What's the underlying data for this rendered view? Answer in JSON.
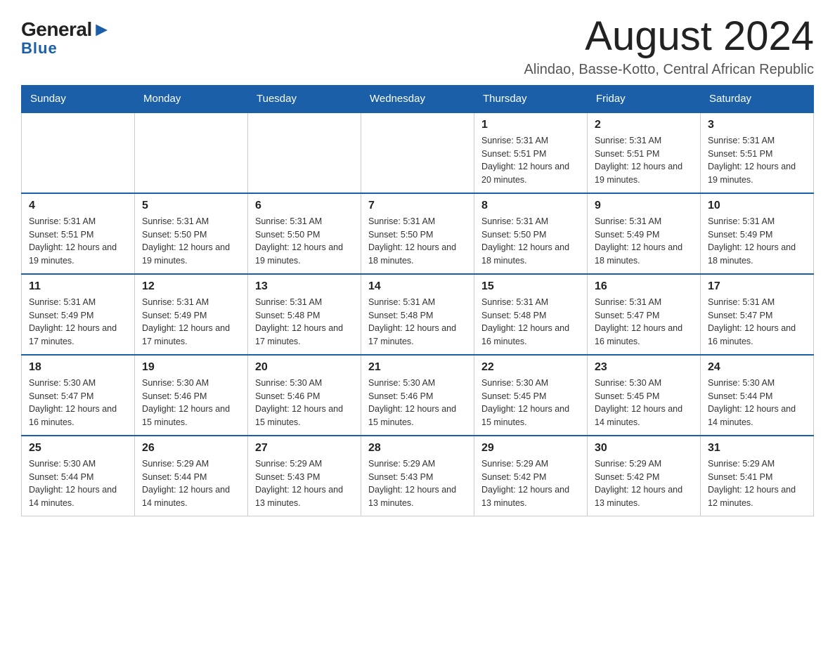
{
  "logo": {
    "general": "General",
    "arrow": "▶",
    "blue": "Blue"
  },
  "title": {
    "month_year": "August 2024",
    "location": "Alindao, Basse-Kotto, Central African Republic"
  },
  "days_of_week": [
    "Sunday",
    "Monday",
    "Tuesday",
    "Wednesday",
    "Thursday",
    "Friday",
    "Saturday"
  ],
  "weeks": [
    [
      {
        "day": "",
        "sunrise": "",
        "sunset": "",
        "daylight": ""
      },
      {
        "day": "",
        "sunrise": "",
        "sunset": "",
        "daylight": ""
      },
      {
        "day": "",
        "sunrise": "",
        "sunset": "",
        "daylight": ""
      },
      {
        "day": "",
        "sunrise": "",
        "sunset": "",
        "daylight": ""
      },
      {
        "day": "1",
        "sunrise": "Sunrise: 5:31 AM",
        "sunset": "Sunset: 5:51 PM",
        "daylight": "Daylight: 12 hours and 20 minutes."
      },
      {
        "day": "2",
        "sunrise": "Sunrise: 5:31 AM",
        "sunset": "Sunset: 5:51 PM",
        "daylight": "Daylight: 12 hours and 19 minutes."
      },
      {
        "day": "3",
        "sunrise": "Sunrise: 5:31 AM",
        "sunset": "Sunset: 5:51 PM",
        "daylight": "Daylight: 12 hours and 19 minutes."
      }
    ],
    [
      {
        "day": "4",
        "sunrise": "Sunrise: 5:31 AM",
        "sunset": "Sunset: 5:51 PM",
        "daylight": "Daylight: 12 hours and 19 minutes."
      },
      {
        "day": "5",
        "sunrise": "Sunrise: 5:31 AM",
        "sunset": "Sunset: 5:50 PM",
        "daylight": "Daylight: 12 hours and 19 minutes."
      },
      {
        "day": "6",
        "sunrise": "Sunrise: 5:31 AM",
        "sunset": "Sunset: 5:50 PM",
        "daylight": "Daylight: 12 hours and 19 minutes."
      },
      {
        "day": "7",
        "sunrise": "Sunrise: 5:31 AM",
        "sunset": "Sunset: 5:50 PM",
        "daylight": "Daylight: 12 hours and 18 minutes."
      },
      {
        "day": "8",
        "sunrise": "Sunrise: 5:31 AM",
        "sunset": "Sunset: 5:50 PM",
        "daylight": "Daylight: 12 hours and 18 minutes."
      },
      {
        "day": "9",
        "sunrise": "Sunrise: 5:31 AM",
        "sunset": "Sunset: 5:49 PM",
        "daylight": "Daylight: 12 hours and 18 minutes."
      },
      {
        "day": "10",
        "sunrise": "Sunrise: 5:31 AM",
        "sunset": "Sunset: 5:49 PM",
        "daylight": "Daylight: 12 hours and 18 minutes."
      }
    ],
    [
      {
        "day": "11",
        "sunrise": "Sunrise: 5:31 AM",
        "sunset": "Sunset: 5:49 PM",
        "daylight": "Daylight: 12 hours and 17 minutes."
      },
      {
        "day": "12",
        "sunrise": "Sunrise: 5:31 AM",
        "sunset": "Sunset: 5:49 PM",
        "daylight": "Daylight: 12 hours and 17 minutes."
      },
      {
        "day": "13",
        "sunrise": "Sunrise: 5:31 AM",
        "sunset": "Sunset: 5:48 PM",
        "daylight": "Daylight: 12 hours and 17 minutes."
      },
      {
        "day": "14",
        "sunrise": "Sunrise: 5:31 AM",
        "sunset": "Sunset: 5:48 PM",
        "daylight": "Daylight: 12 hours and 17 minutes."
      },
      {
        "day": "15",
        "sunrise": "Sunrise: 5:31 AM",
        "sunset": "Sunset: 5:48 PM",
        "daylight": "Daylight: 12 hours and 16 minutes."
      },
      {
        "day": "16",
        "sunrise": "Sunrise: 5:31 AM",
        "sunset": "Sunset: 5:47 PM",
        "daylight": "Daylight: 12 hours and 16 minutes."
      },
      {
        "day": "17",
        "sunrise": "Sunrise: 5:31 AM",
        "sunset": "Sunset: 5:47 PM",
        "daylight": "Daylight: 12 hours and 16 minutes."
      }
    ],
    [
      {
        "day": "18",
        "sunrise": "Sunrise: 5:30 AM",
        "sunset": "Sunset: 5:47 PM",
        "daylight": "Daylight: 12 hours and 16 minutes."
      },
      {
        "day": "19",
        "sunrise": "Sunrise: 5:30 AM",
        "sunset": "Sunset: 5:46 PM",
        "daylight": "Daylight: 12 hours and 15 minutes."
      },
      {
        "day": "20",
        "sunrise": "Sunrise: 5:30 AM",
        "sunset": "Sunset: 5:46 PM",
        "daylight": "Daylight: 12 hours and 15 minutes."
      },
      {
        "day": "21",
        "sunrise": "Sunrise: 5:30 AM",
        "sunset": "Sunset: 5:46 PM",
        "daylight": "Daylight: 12 hours and 15 minutes."
      },
      {
        "day": "22",
        "sunrise": "Sunrise: 5:30 AM",
        "sunset": "Sunset: 5:45 PM",
        "daylight": "Daylight: 12 hours and 15 minutes."
      },
      {
        "day": "23",
        "sunrise": "Sunrise: 5:30 AM",
        "sunset": "Sunset: 5:45 PM",
        "daylight": "Daylight: 12 hours and 14 minutes."
      },
      {
        "day": "24",
        "sunrise": "Sunrise: 5:30 AM",
        "sunset": "Sunset: 5:44 PM",
        "daylight": "Daylight: 12 hours and 14 minutes."
      }
    ],
    [
      {
        "day": "25",
        "sunrise": "Sunrise: 5:30 AM",
        "sunset": "Sunset: 5:44 PM",
        "daylight": "Daylight: 12 hours and 14 minutes."
      },
      {
        "day": "26",
        "sunrise": "Sunrise: 5:29 AM",
        "sunset": "Sunset: 5:44 PM",
        "daylight": "Daylight: 12 hours and 14 minutes."
      },
      {
        "day": "27",
        "sunrise": "Sunrise: 5:29 AM",
        "sunset": "Sunset: 5:43 PM",
        "daylight": "Daylight: 12 hours and 13 minutes."
      },
      {
        "day": "28",
        "sunrise": "Sunrise: 5:29 AM",
        "sunset": "Sunset: 5:43 PM",
        "daylight": "Daylight: 12 hours and 13 minutes."
      },
      {
        "day": "29",
        "sunrise": "Sunrise: 5:29 AM",
        "sunset": "Sunset: 5:42 PM",
        "daylight": "Daylight: 12 hours and 13 minutes."
      },
      {
        "day": "30",
        "sunrise": "Sunrise: 5:29 AM",
        "sunset": "Sunset: 5:42 PM",
        "daylight": "Daylight: 12 hours and 13 minutes."
      },
      {
        "day": "31",
        "sunrise": "Sunrise: 5:29 AM",
        "sunset": "Sunset: 5:41 PM",
        "daylight": "Daylight: 12 hours and 12 minutes."
      }
    ]
  ]
}
